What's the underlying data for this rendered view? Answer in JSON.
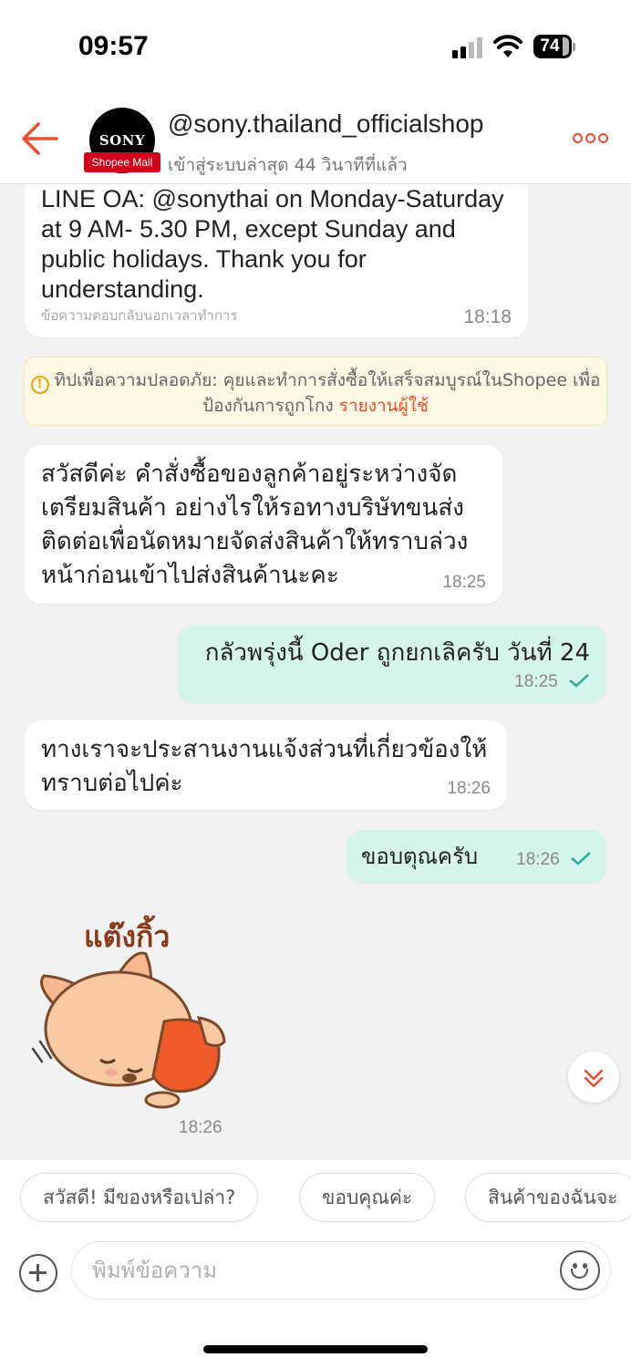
{
  "status_bar": {
    "time": "09:57",
    "battery": "74"
  },
  "header": {
    "avatar_text": "SONY",
    "badge": "Shopee Mall",
    "shop_name": "@sony.thailand_officialshop",
    "last_seen": "เข้าสู่ระบบล่าสุด 44 วินาทีที่แล้ว"
  },
  "messages": [
    {
      "direction": "in",
      "text": "LINE OA: @sonythai on Monday-Saturday at 9 AM- 5.30 PM, except Sunday and public holidays. Thank you for understanding.",
      "note": "ข้อความตอบกลับนอกเวลาทำการ",
      "time": "18:18"
    },
    {
      "direction": "in",
      "text": "สวัสดีค่ะ คำสั่งซื้อของลูกค้าอยู่ระหว่างจัดเตรียมสินค้า อย่างไรให้รอทางบริษัทขนส่งติดต่อเพื่อนัดหมายจัดส่งสินค้าให้ทราบล่วงหน้าก่อนเข้าไปส่งสินค้านะคะ",
      "time": "18:25"
    },
    {
      "direction": "out",
      "text": "กลัวพรุ่งนี้ Oder ถูกยกเลิครับ วันที่ 24",
      "time": "18:25"
    },
    {
      "direction": "in",
      "text": "ทางเราจะประสานงานแจ้งส่วนที่เกี่ยวข้องให้ทราบต่อไปค่ะ",
      "time": "18:26"
    },
    {
      "direction": "out",
      "text": "ขอบตุณครับ",
      "time": "18:26"
    },
    {
      "direction": "in",
      "sticker": "แต๊งกิ้ว",
      "time": "18:26"
    }
  ],
  "tip": {
    "text": "ทิปเพื่อความปลอดภัย: คุยและทำการสั่งซื้อให้เสร็จสมบูรณ์ในShopee เพื่อป้องกันการถูกโกง",
    "link": "รายงานผู้ใช้"
  },
  "quick_replies": [
    "สวัสดี! มีของหรือเปล่า?",
    "ขอบคุณค่ะ",
    "สินค้าของฉันจะ"
  ],
  "composer": {
    "placeholder": "พิมพ์ข้อความ"
  },
  "colors": {
    "accent": "#ee4d2d",
    "outgoing_bubble": "#d4f4ec",
    "tick": "#26aa99"
  }
}
